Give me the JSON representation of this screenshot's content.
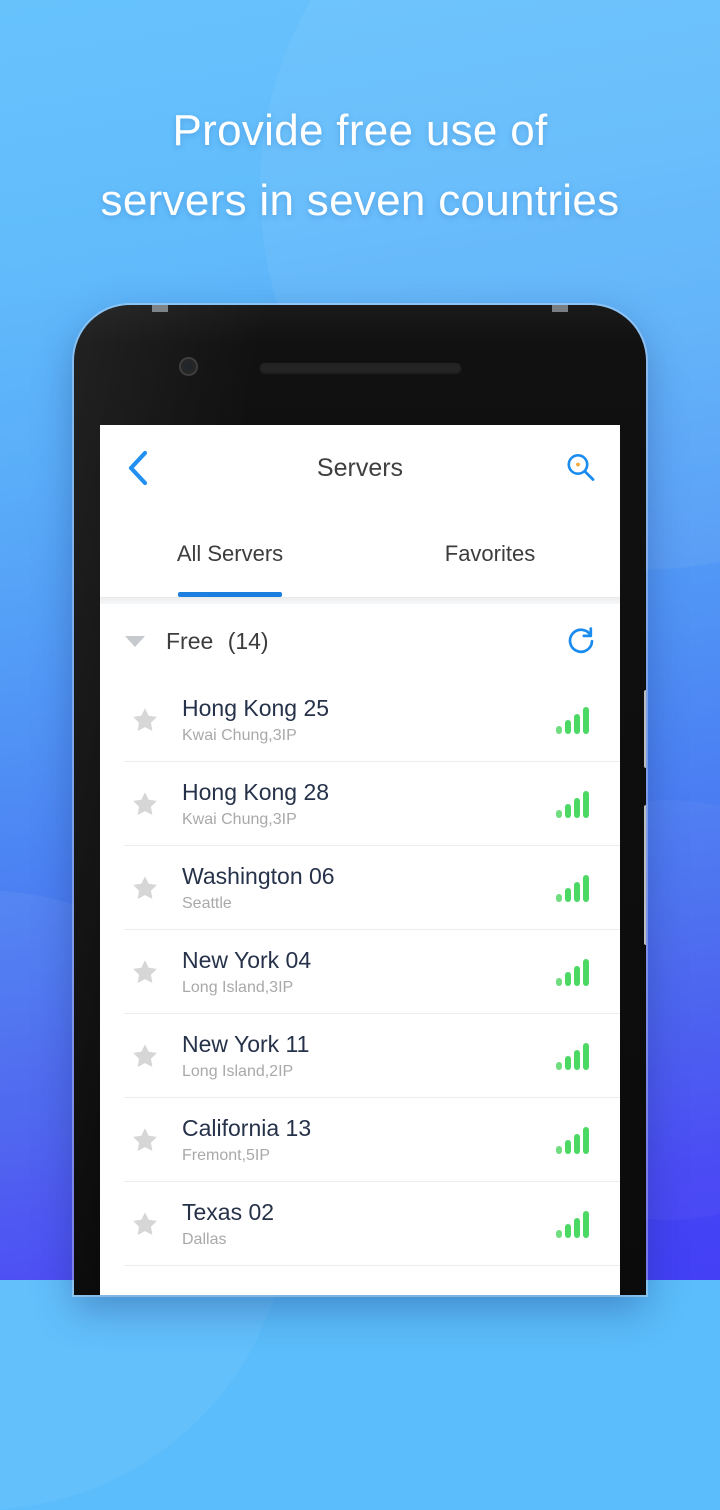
{
  "promo": {
    "headline_line1": "Provide free use of",
    "headline_line2": "servers in seven countries",
    "bg_color_top": "#67c2fc",
    "bg_color_bottom": "#4340f6"
  },
  "app": {
    "navbar": {
      "back_icon": "chevron-left-icon",
      "title": "Servers",
      "search_icon": "search-icon",
      "accent_color": "#1a8cf0"
    },
    "tabs": [
      {
        "label": "All Servers",
        "active": true
      },
      {
        "label": "Favorites",
        "active": false
      }
    ],
    "group": {
      "caret_icon": "triangle-down-icon",
      "title": "Free",
      "count": "(14)",
      "refresh_icon": "refresh-icon"
    },
    "servers": [
      {
        "name": "Hong Kong 25",
        "location": "Kwai Chung,3IP",
        "favorite": false,
        "signal": 4
      },
      {
        "name": "Hong Kong 28",
        "location": "Kwai Chung,3IP",
        "favorite": false,
        "signal": 4
      },
      {
        "name": "Washington 06",
        "location": "Seattle",
        "favorite": false,
        "signal": 4
      },
      {
        "name": "New York 04",
        "location": "Long Island,3IP",
        "favorite": false,
        "signal": 4
      },
      {
        "name": "New York 11",
        "location": "Long Island,2IP",
        "favorite": false,
        "signal": 4
      },
      {
        "name": "California 13",
        "location": "Fremont,5IP",
        "favorite": false,
        "signal": 4
      },
      {
        "name": "Texas 02",
        "location": "Dallas",
        "favorite": false,
        "signal": 4
      }
    ],
    "colors": {
      "server_name": "#26324a",
      "server_location": "#a9a9a9",
      "signal_green": "#4bd863",
      "tab_underline": "#1a7ee0",
      "star_gray": "#d6d6d6"
    }
  }
}
